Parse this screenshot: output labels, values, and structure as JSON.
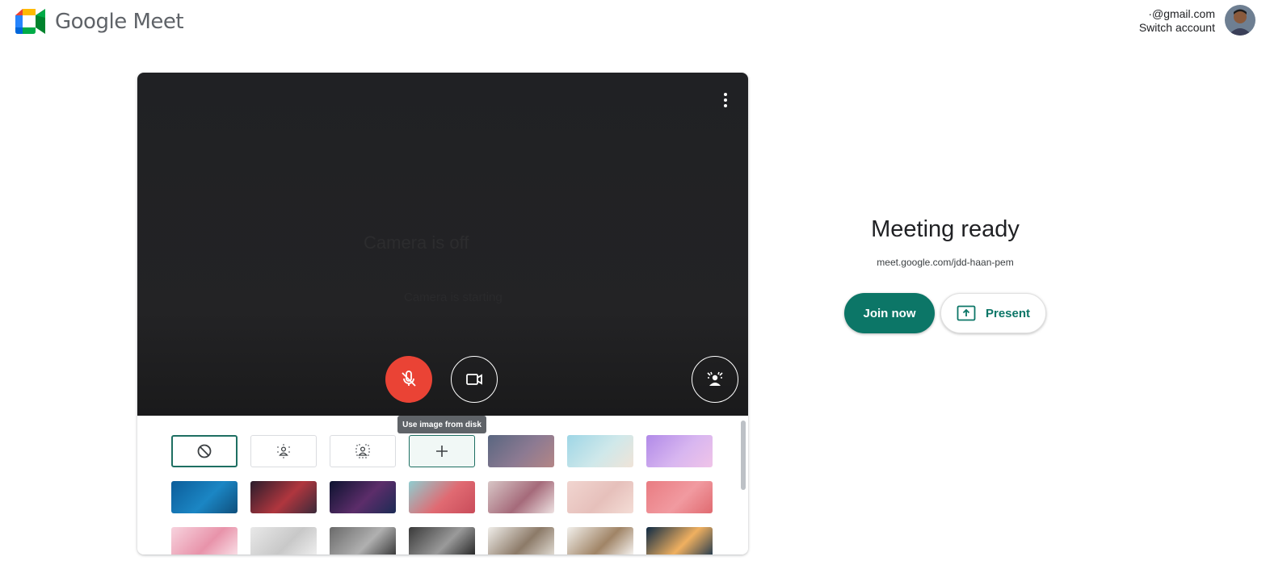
{
  "app": {
    "name": "Google Meet",
    "logo_icon": "google-meet-logo-icon"
  },
  "account": {
    "email": "·@gmail.com",
    "switch_label": "Switch account",
    "avatar_icon": "avatar"
  },
  "preview": {
    "more_icon": "more-vert-icon",
    "camera_off_text": "Camera is off",
    "camera_off_subtext": "Camera is starting",
    "controls": [
      {
        "name": "microphone-off",
        "icon": "mic-off-icon",
        "state": "muted",
        "color": "#ea4335"
      },
      {
        "name": "camera",
        "icon": "videocam-icon",
        "state": "on"
      },
      {
        "name": "visual-effects",
        "icon": "visual-effects-icon"
      }
    ],
    "tooltip": "Use image from disk"
  },
  "backgrounds": {
    "tiles": [
      {
        "id": "no-effect",
        "icon": "block-icon",
        "selected": true
      },
      {
        "id": "slight-blur",
        "icon": "blur-slight-icon"
      },
      {
        "id": "blur",
        "icon": "blur-icon"
      },
      {
        "id": "upload-image",
        "icon": "plus-icon"
      },
      {
        "id": "sunset",
        "colors": [
          "#596680",
          "#8c7a92",
          "#b48686"
        ]
      },
      {
        "id": "beach",
        "colors": [
          "#9ed6e6",
          "#cfe8ea",
          "#f0e4d8"
        ]
      },
      {
        "id": "clouds",
        "colors": [
          "#b18ae8",
          "#d8b6f0",
          "#f0c4e8"
        ]
      },
      {
        "id": "water",
        "colors": [
          "#0c5d9a",
          "#1b86c4",
          "#0f4f7c"
        ]
      },
      {
        "id": "nebula",
        "colors": [
          "#2a1d2c",
          "#b0363e",
          "#3b2a3a"
        ]
      },
      {
        "id": "fireworks",
        "colors": [
          "#0d1330",
          "#5c2d6a",
          "#1c2b55"
        ]
      },
      {
        "id": "flowers-sky",
        "colors": [
          "#8fcdd0",
          "#e06a72",
          "#c94c5a"
        ]
      },
      {
        "id": "blossoms",
        "colors": [
          "#d8c6c6",
          "#a56a7a",
          "#eee2e2"
        ]
      },
      {
        "id": "pink-confetti",
        "colors": [
          "#f1d5d0",
          "#e6c0bb",
          "#f4ddd6"
        ]
      },
      {
        "id": "pink-pattern",
        "colors": [
          "#e97c82",
          "#f19aa0",
          "#e06a70"
        ]
      },
      {
        "id": "petals",
        "colors": [
          "#f7d3de",
          "#e893aa",
          "#fbe6ec"
        ]
      },
      {
        "id": "white-room",
        "colors": [
          "#e8e8e8",
          "#c8c8c8",
          "#f2f2f2"
        ]
      },
      {
        "id": "loft",
        "colors": [
          "#6a6a6a",
          "#b0b0b0",
          "#2e2e2e"
        ]
      },
      {
        "id": "dark-room",
        "colors": [
          "#3a3a3a",
          "#9a9a9a",
          "#1c1c1c"
        ]
      },
      {
        "id": "shelves",
        "colors": [
          "#f0eeea",
          "#8c7a68",
          "#e8e4dc"
        ]
      },
      {
        "id": "bookcase",
        "colors": [
          "#f2f0ec",
          "#a08466",
          "#ffffff"
        ]
      },
      {
        "id": "night-house",
        "colors": [
          "#0e2a44",
          "#f0b060",
          "#13324e"
        ]
      }
    ]
  },
  "meeting": {
    "title": "Meeting ready",
    "link": "meet.google.com/jdd-haan-pem",
    "join_label": "Join now",
    "present_label": "Present",
    "present_icon": "present-to-all-icon",
    "accent_color": "#0c7667"
  }
}
